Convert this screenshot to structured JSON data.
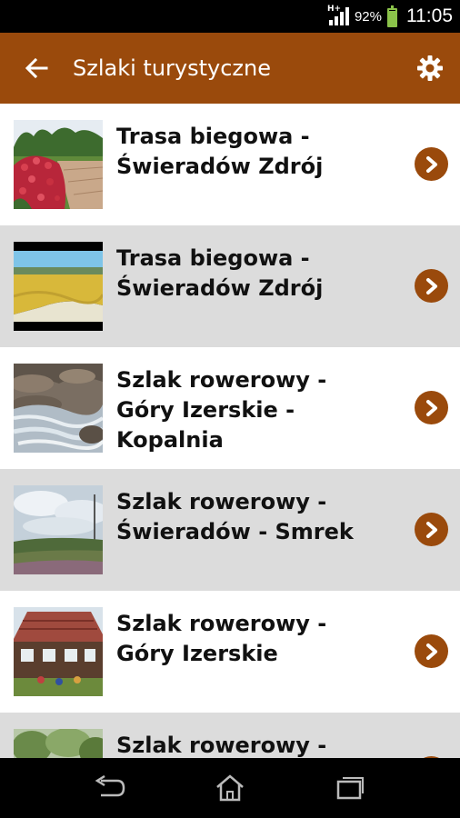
{
  "status_bar": {
    "network_label": "H+",
    "battery_percent": "92%",
    "battery_level": 0.92,
    "time": "11:05"
  },
  "app_bar": {
    "title": "Szlaki turystyczne",
    "back_icon": "arrow-left-icon",
    "settings_icon": "gear-icon",
    "color": "#9a4a0c"
  },
  "trails": [
    {
      "title": "Trasa biegowa - Świeradów Zdrój",
      "thumb": "garden-path-photo",
      "chevron_icon": "chevron-right-icon"
    },
    {
      "title": "Trasa biegowa - Świeradów Zdrój",
      "thumb": "meadow-landscape-photo",
      "chevron_icon": "chevron-right-icon"
    },
    {
      "title": "Szlak rowerowy - Góry Izerskie - Kopalnia",
      "thumb": "mountain-stream-photo",
      "chevron_icon": "chevron-right-icon"
    },
    {
      "title": "Szlak rowerowy - Świeradów - Smrek",
      "thumb": "cloudy-hill-photo",
      "chevron_icon": "chevron-right-icon"
    },
    {
      "title": "Szlak rowerowy - Góry Izerskie",
      "thumb": "mountain-hut-photo",
      "chevron_icon": "chevron-right-icon"
    },
    {
      "title": "Szlak rowerowy -",
      "thumb": "forest-photo",
      "chevron_icon": "chevron-right-icon"
    }
  ],
  "nav_bar": {
    "back_icon": "nav-back-icon",
    "home_icon": "nav-home-icon",
    "recents_icon": "nav-recents-icon"
  }
}
